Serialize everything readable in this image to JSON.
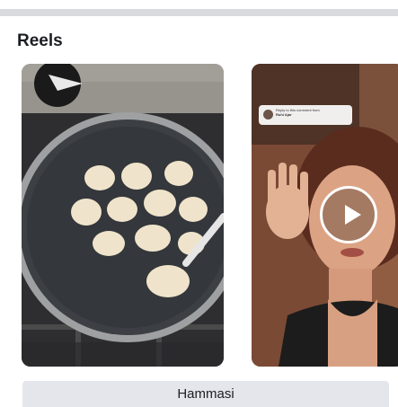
{
  "section": {
    "title": "Reels"
  },
  "reels": [
    {
      "thumbnail": "pancakes-in-pan"
    },
    {
      "thumbnail": "woman-waving",
      "caption_line": "Reply to this comment from",
      "caption_name": "Ruhi Ajar",
      "play_icon": "play-icon"
    }
  ],
  "footer": {
    "all_label": "Hammasi"
  },
  "colors": {
    "top_bar": "#d9dadd",
    "button_bg": "#e4e6eb",
    "text": "#1c1e21"
  }
}
